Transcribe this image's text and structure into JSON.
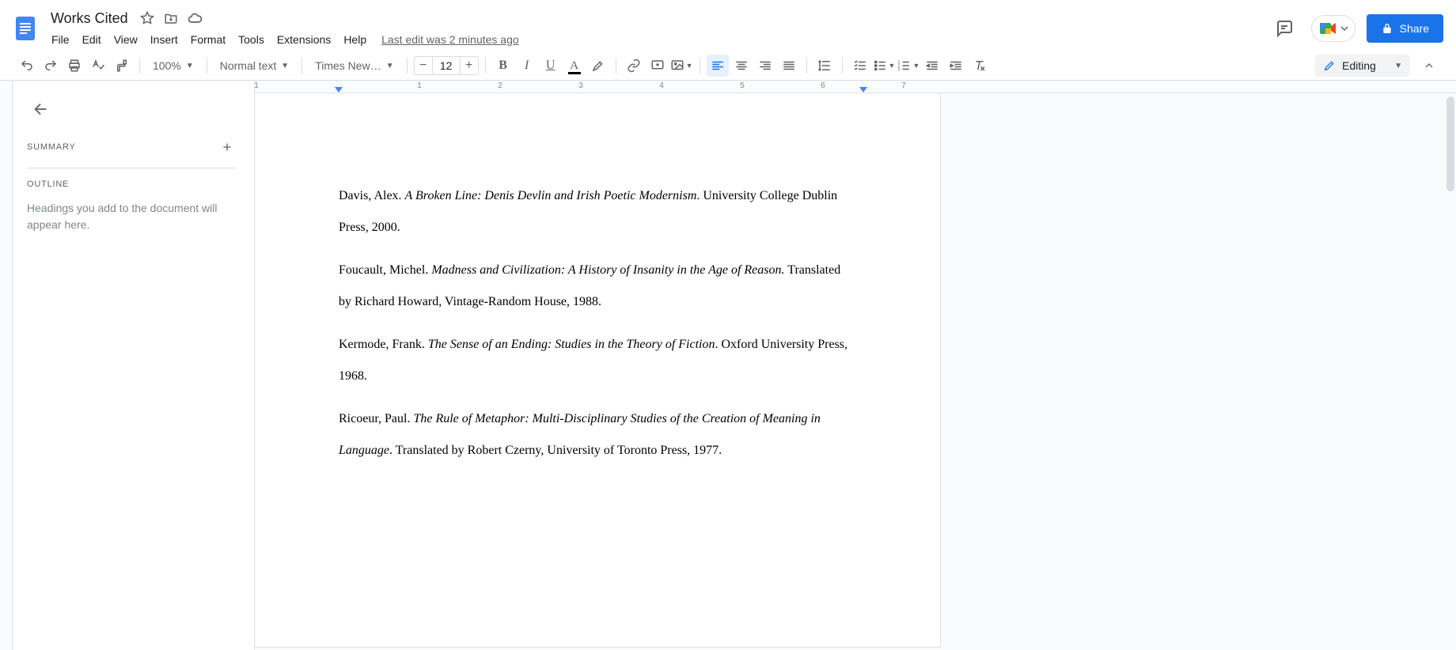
{
  "header": {
    "doc_title": "Works Cited",
    "last_edit": "Last edit was 2 minutes ago",
    "share_label": "Share"
  },
  "menus": [
    "File",
    "Edit",
    "View",
    "Insert",
    "Format",
    "Tools",
    "Extensions",
    "Help"
  ],
  "toolbar": {
    "zoom": "100%",
    "style": "Normal text",
    "font": "Times New…",
    "font_size": "12",
    "editing_label": "Editing"
  },
  "outline": {
    "summary_label": "SUMMARY",
    "outline_label": "OUTLINE",
    "empty_text": "Headings you add to the document will appear here."
  },
  "ruler_numbers": [
    "1",
    "1",
    "2",
    "3",
    "4",
    "5",
    "6",
    "7"
  ],
  "document": {
    "entries": [
      {
        "pre": "Davis, Alex. ",
        "title": "A Broken Line: Denis Devlin and Irish Poetic Modernism",
        "post": ". University College Dublin Press, 2000."
      },
      {
        "pre": "Foucault, Michel. ",
        "title": "Madness and Civilization: A History of Insanity in the Age of Reason.",
        "post": " Translated by Richard Howard, Vintage-Random House, 1988."
      },
      {
        "pre": "Kermode, Frank. ",
        "title": "The Sense of an Ending: Studies in the Theory of Fiction",
        "post": ". Oxford University Press, 1968."
      },
      {
        "pre": "Ricoeur, Paul. ",
        "title": "The Rule of Metaphor: Multi-Disciplinary Studies of the Creation of Meaning in Language",
        "post": ". Translated by Robert Czerny, University of Toronto Press, 1977."
      }
    ]
  }
}
